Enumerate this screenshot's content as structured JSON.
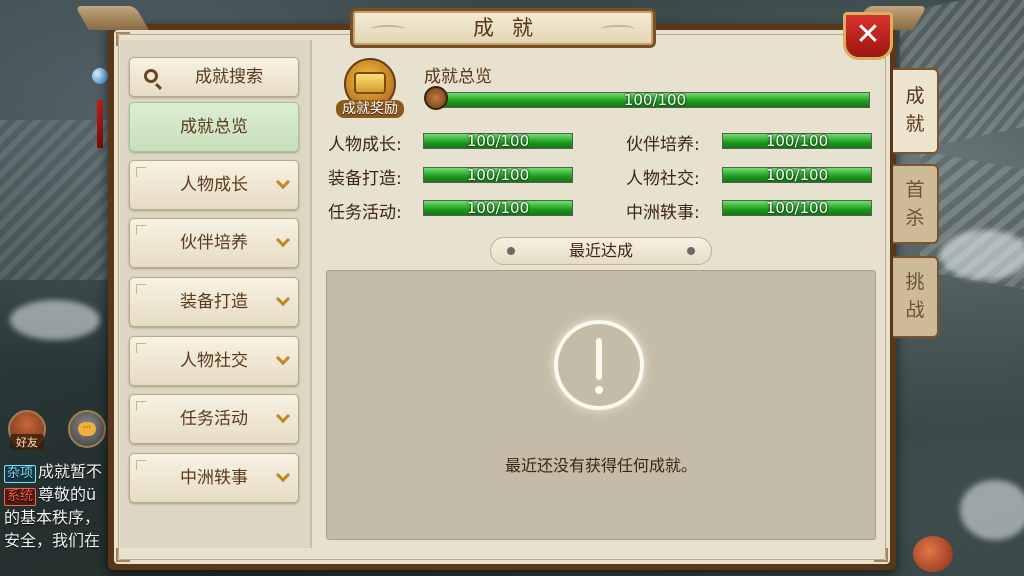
{
  "window": {
    "title": "成就",
    "close": "✕"
  },
  "tabs": [
    {
      "label": "成就",
      "active": true
    },
    {
      "label": "首杀",
      "active": false
    },
    {
      "label": "挑战",
      "active": false
    }
  ],
  "menu": {
    "search": "成就搜索",
    "overview": "成就总览",
    "categories": [
      "人物成长",
      "伙伴培养",
      "装备打造",
      "人物社交",
      "任务活动",
      "中洲轶事"
    ]
  },
  "overview": {
    "chest_label": "成就奖励",
    "title": "成就总览",
    "total": {
      "value": "100/100",
      "progress": 1.0
    },
    "stats": [
      {
        "label": "人物成长:",
        "value": "100/100",
        "progress": 1.0
      },
      {
        "label": "伙伴培养:",
        "value": "100/100",
        "progress": 1.0
      },
      {
        "label": "装备打造:",
        "value": "100/100",
        "progress": 1.0
      },
      {
        "label": "人物社交:",
        "value": "100/100",
        "progress": 1.0
      },
      {
        "label": "任务活动:",
        "value": "100/100",
        "progress": 1.0
      },
      {
        "label": "中洲轶事:",
        "value": "100/100",
        "progress": 1.0
      }
    ]
  },
  "recent": {
    "header": "最近达成",
    "empty_message": "最近还没有获得任何成就。"
  },
  "hud": {
    "friend_label": "好友",
    "chat": [
      {
        "tag": "杂项",
        "text": "成就暂不"
      },
      {
        "tag": "系统",
        "text": "尊敬的ü"
      },
      {
        "tag": "",
        "text": "的基本秩序，"
      },
      {
        "tag": "",
        "text": "安全，我们在"
      }
    ]
  },
  "colors": {
    "bar_fill": "#1d9a1d",
    "panel_border": "#5b3719",
    "close_red": "#c42218"
  }
}
